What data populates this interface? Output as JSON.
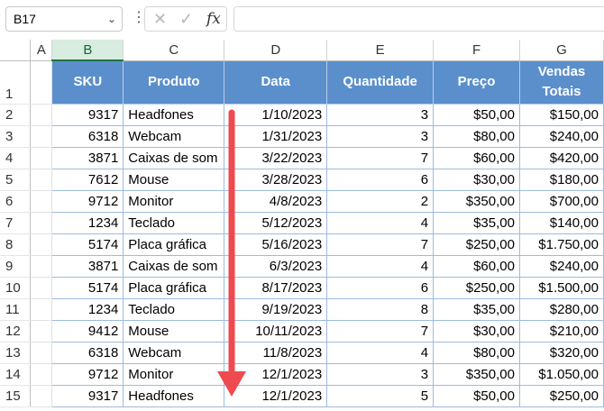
{
  "toolbar": {
    "name_box": "B17",
    "chevron": "⌄",
    "dots": "⋮",
    "cancel_icon": "✕",
    "enter_icon": "✓",
    "fx_label": "fx",
    "formula_value": ""
  },
  "columns": [
    "A",
    "B",
    "C",
    "D",
    "E",
    "F",
    "G"
  ],
  "rows": [
    "1",
    "2",
    "3",
    "4",
    "5",
    "6",
    "7",
    "8",
    "9",
    "10",
    "11",
    "12",
    "13",
    "14",
    "15"
  ],
  "headers": {
    "sku": "SKU",
    "produto": "Produto",
    "data": "Data",
    "quantidade": "Quantidade",
    "preco": "Preço",
    "vendas": "Vendas Totais"
  },
  "table": [
    {
      "sku": "9317",
      "produto": "Headfones",
      "data": "1/10/2023",
      "qtd": "3",
      "preco": "$50,00",
      "vendas": "$150,00"
    },
    {
      "sku": "6318",
      "produto": "Webcam",
      "data": "1/31/2023",
      "qtd": "3",
      "preco": "$80,00",
      "vendas": "$240,00"
    },
    {
      "sku": "3871",
      "produto": "Caixas de som",
      "data": "3/22/2023",
      "qtd": "7",
      "preco": "$60,00",
      "vendas": "$420,00"
    },
    {
      "sku": "7612",
      "produto": "Mouse",
      "data": "3/28/2023",
      "qtd": "6",
      "preco": "$30,00",
      "vendas": "$180,00"
    },
    {
      "sku": "9712",
      "produto": "Monitor",
      "data": "4/8/2023",
      "qtd": "2",
      "preco": "$350,00",
      "vendas": "$700,00"
    },
    {
      "sku": "1234",
      "produto": "Teclado",
      "data": "5/12/2023",
      "qtd": "4",
      "preco": "$35,00",
      "vendas": "$140,00"
    },
    {
      "sku": "5174",
      "produto": "Placa gráfica",
      "data": "5/16/2023",
      "qtd": "7",
      "preco": "$250,00",
      "vendas": "$1.750,00"
    },
    {
      "sku": "3871",
      "produto": "Caixas de som",
      "data": "6/3/2023",
      "qtd": "4",
      "preco": "$60,00",
      "vendas": "$240,00"
    },
    {
      "sku": "5174",
      "produto": "Placa gráfica",
      "data": "8/17/2023",
      "qtd": "6",
      "preco": "$250,00",
      "vendas": "$1.500,00"
    },
    {
      "sku": "1234",
      "produto": "Teclado",
      "data": "9/19/2023",
      "qtd": "8",
      "preco": "$35,00",
      "vendas": "$280,00"
    },
    {
      "sku": "9412",
      "produto": "Mouse",
      "data": "10/11/2023",
      "qtd": "7",
      "preco": "$30,00",
      "vendas": "$210,00"
    },
    {
      "sku": "6318",
      "produto": "Webcam",
      "data": "11/8/2023",
      "qtd": "4",
      "preco": "$80,00",
      "vendas": "$320,00"
    },
    {
      "sku": "9712",
      "produto": "Monitor",
      "data": "12/1/2023",
      "qtd": "3",
      "preco": "$350,00",
      "vendas": "$1.050,00"
    },
    {
      "sku": "9317",
      "produto": "Headfones",
      "data": "12/1/2023",
      "qtd": "5",
      "preco": "$50,00",
      "vendas": "$250,00"
    }
  ],
  "colors": {
    "header_fill": "#5b8fcc",
    "selected_column": "#d8ecdf",
    "arrow": "#ee4a4f"
  }
}
